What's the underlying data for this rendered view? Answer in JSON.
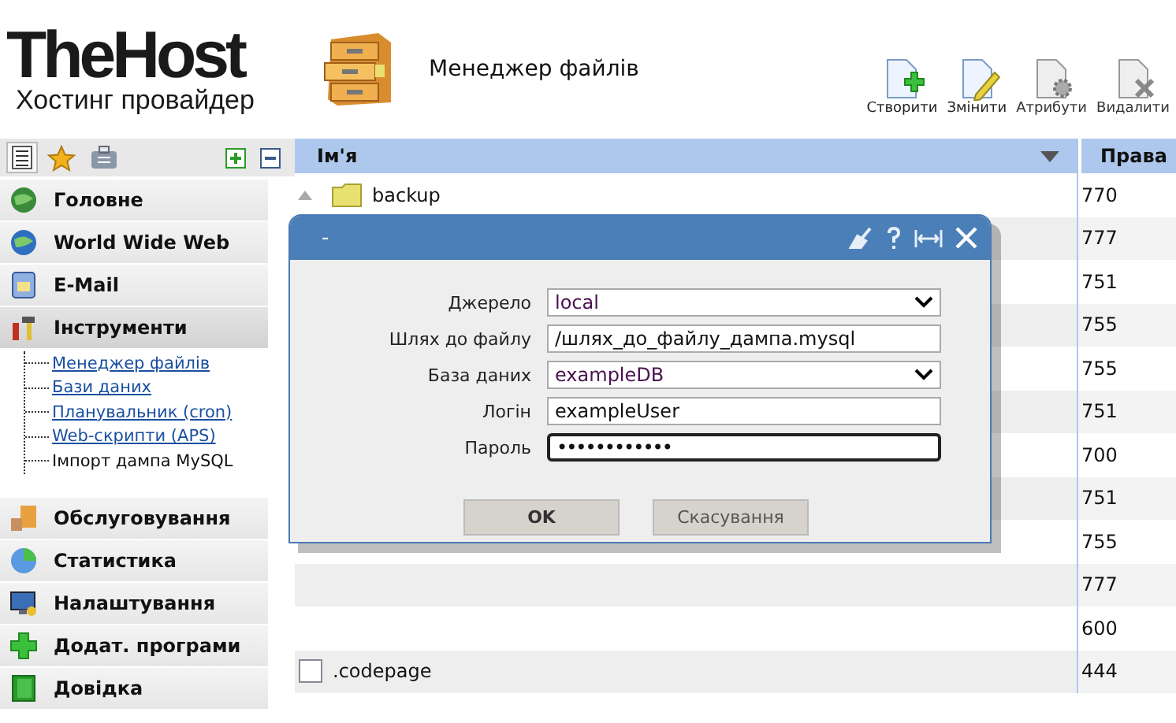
{
  "logo": {
    "name": "TheHost",
    "tagline": "Хостинг провайдер"
  },
  "page_title": "Менеджер файлів",
  "toolbar": [
    {
      "label": "Створити",
      "kind": "create",
      "disabled": false
    },
    {
      "label": "Змінити",
      "kind": "edit",
      "disabled": false
    },
    {
      "label": "Атрибути",
      "kind": "attributes",
      "disabled": true
    },
    {
      "label": "Видалити",
      "kind": "delete",
      "disabled": true
    }
  ],
  "sidebar": {
    "tabs": [
      {
        "kind": "list",
        "selected": true
      },
      {
        "kind": "favorites",
        "selected": false
      },
      {
        "kind": "briefcase",
        "selected": false
      }
    ],
    "sections": [
      {
        "label": "Головне",
        "kind": "home",
        "expanded": false
      },
      {
        "label": "World Wide Web",
        "kind": "web",
        "expanded": false
      },
      {
        "label": "E-Mail",
        "kind": "mail",
        "expanded": false
      },
      {
        "label": "Інструменти",
        "kind": "tools",
        "expanded": true,
        "children": [
          {
            "label": "Менеджер файлів",
            "selected": false
          },
          {
            "label": "Бази даних",
            "selected": false
          },
          {
            "label": "Планувальник (cron)",
            "selected": false
          },
          {
            "label": "Web-скрипти (APS)",
            "selected": false
          },
          {
            "label": "Імпорт дампа MySQL",
            "selected": true
          }
        ]
      },
      {
        "label": "Обслуговування",
        "kind": "service",
        "expanded": false
      },
      {
        "label": "Статистика",
        "kind": "stats",
        "expanded": false
      },
      {
        "label": "Налаштування",
        "kind": "settings",
        "expanded": false
      },
      {
        "label": "Додат. програми",
        "kind": "addons",
        "expanded": false
      },
      {
        "label": "Довідка",
        "kind": "help",
        "expanded": false
      }
    ]
  },
  "table": {
    "columns": [
      "Ім'я",
      "Права"
    ],
    "rows": [
      {
        "name": "backup",
        "kind": "folder",
        "rights": "770"
      },
      {
        "rights": "777"
      },
      {
        "rights": "751"
      },
      {
        "rights": "755"
      },
      {
        "rights": "755"
      },
      {
        "rights": "751"
      },
      {
        "rights": "700"
      },
      {
        "rights": "751"
      },
      {
        "rights": "755"
      },
      {
        "rights": "777"
      },
      {
        "rights": "600"
      },
      {
        "name": ".codepage",
        "kind": "file",
        "rights": "444"
      }
    ]
  },
  "dialog": {
    "title": "-",
    "fields": [
      {
        "label": "Джерело",
        "kind": "select",
        "value": "local",
        "focused": false
      },
      {
        "label": "Шлях до файлу",
        "kind": "text",
        "value": "/шлях_до_файлу_дампа.mysql",
        "focused": false
      },
      {
        "label": "База даних",
        "kind": "select",
        "value": "exampleDB",
        "focused": false
      },
      {
        "label": "Логін",
        "kind": "text",
        "value": "exampleUser",
        "focused": false
      },
      {
        "label": "Пароль",
        "kind": "password",
        "value": "••••••••••••",
        "focused": true
      }
    ],
    "buttons": [
      "OK",
      "Скасування"
    ]
  }
}
